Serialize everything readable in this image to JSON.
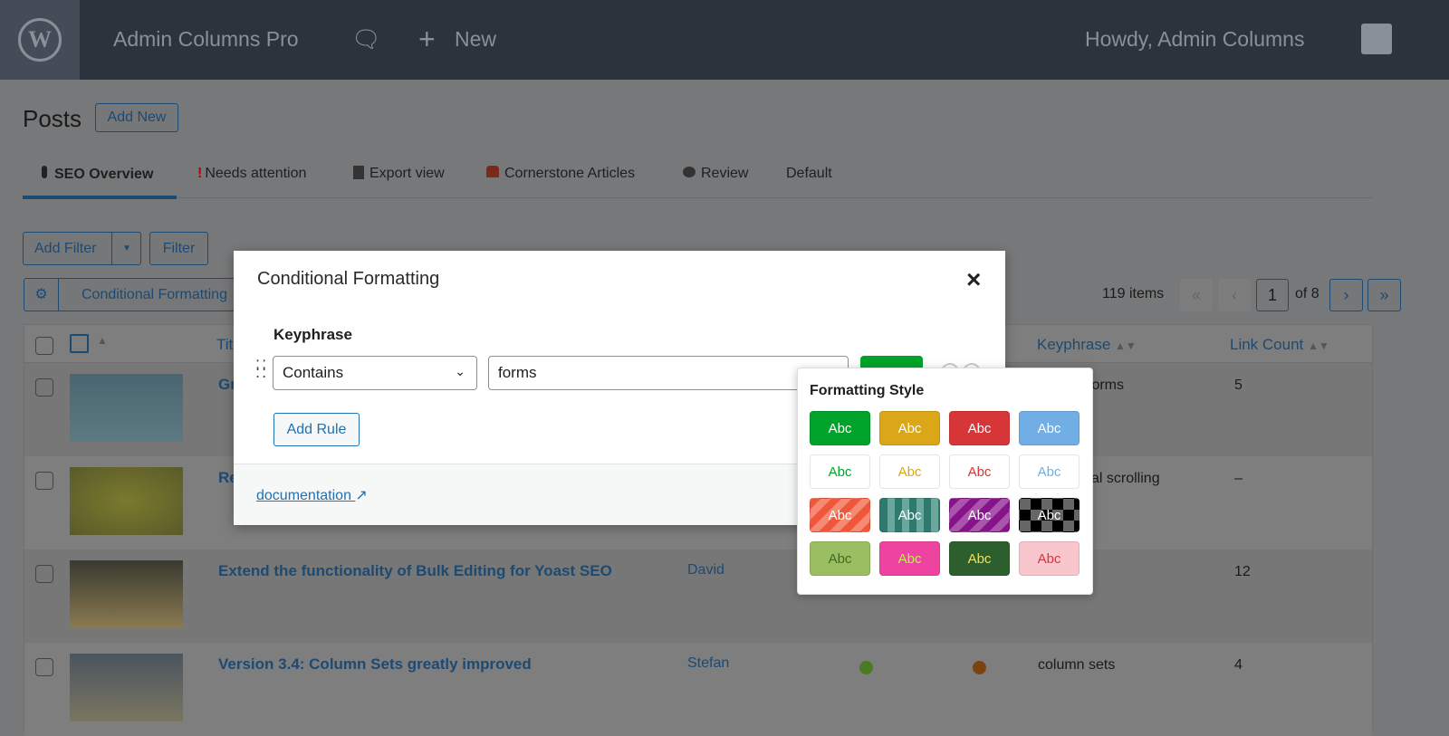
{
  "topbar": {
    "site": "Admin Columns Pro",
    "new": "New",
    "howdy": "Howdy, Admin Columns",
    "logo": "W"
  },
  "page": {
    "title": "Posts",
    "add_new": "Add New"
  },
  "tabs": [
    {
      "icon": "traffic-light",
      "label": "SEO Overview"
    },
    {
      "icon": "exclamation",
      "label": "Needs attention"
    },
    {
      "icon": "cabinet",
      "label": "Export view"
    },
    {
      "icon": "stamp",
      "label": "Cornerstone Articles"
    },
    {
      "icon": "eye",
      "label": "Review"
    },
    {
      "icon": "",
      "label": "Default"
    }
  ],
  "filters": {
    "add_filter": "Add Filter",
    "filter": "Filter",
    "conditional": "Conditional Formatting"
  },
  "pagination": {
    "items": "119 items",
    "current": "1",
    "of": "of 8",
    "first": "«",
    "prev": "‹",
    "next": "›",
    "last": "»"
  },
  "table": {
    "columns": {
      "title": "Title",
      "keyphrase": "Keyphrase",
      "link_count": "Link Count"
    },
    "rows": [
      {
        "title": "Gr",
        "author": "",
        "seo": "",
        "read": "",
        "keyphrase": "forms",
        "links": "5"
      },
      {
        "title": "Re",
        "author": "",
        "seo": "",
        "read": "",
        "keyphrase": "al scrolling",
        "links": "–"
      },
      {
        "title": "Extend the functionality of Bulk Editing for Yoast SEO",
        "author": "David",
        "seo": "",
        "read": "",
        "keyphrase": "",
        "links": "12"
      },
      {
        "title": "Version 3.4: Column Sets greatly improved",
        "author": "Stefan",
        "seo": "#4a7a22",
        "read": "#7a4410",
        "keyphrase": "column sets",
        "links": "4"
      }
    ]
  },
  "modal": {
    "title": "Conditional Formatting",
    "field": "Keyphrase",
    "operator": "Contains",
    "value": "forms",
    "add_rule": "Add Rule",
    "documentation": "documentation",
    "close": "×",
    "style_color": "#00a32a"
  },
  "popover": {
    "title": "Formatting Style",
    "swatches": [
      {
        "label": "Abc",
        "bg": "#00a32a",
        "fg": "#ffffff"
      },
      {
        "label": "Abc",
        "bg": "#dba617",
        "fg": "#ffffff"
      },
      {
        "label": "Abc",
        "bg": "#d63638",
        "fg": "#ffffff"
      },
      {
        "label": "Abc",
        "bg": "#72aee6",
        "fg": "#ffffff"
      },
      {
        "label": "Abc",
        "bg": "#ffffff",
        "fg": "#00a32a"
      },
      {
        "label": "Abc",
        "bg": "#ffffff",
        "fg": "#dba617"
      },
      {
        "label": "Abc",
        "bg": "#ffffff",
        "fg": "#d63638"
      },
      {
        "label": "Abc",
        "bg": "#ffffff",
        "fg": "#72aee6"
      },
      {
        "label": "Abc",
        "bg": "repeating-linear-gradient(135deg,#f0573a 0 8px,#f58a75 8px 16px)",
        "fg": "#ffffff"
      },
      {
        "label": "Abc",
        "bg": "repeating-linear-gradient(90deg,#2f7a6e 0 8px,#6aa79d 8px 16px)",
        "fg": "#ffffff"
      },
      {
        "label": "Abc",
        "bg": "repeating-linear-gradient(135deg,#87138a 0 8px,#a955ab 8px 16px)",
        "fg": "#ffffff"
      },
      {
        "label": "Abc",
        "bg": "repeating-conic-gradient(#000 0 25%,#666 0 50%) 0 0/24px 24px",
        "fg": "#ffffff"
      },
      {
        "label": "Abc",
        "bg": "#9bbe63",
        "fg": "#3d6a1c"
      },
      {
        "label": "Abc",
        "bg": "#ee43a0",
        "fg": "#c5f050"
      },
      {
        "label": "Abc",
        "bg": "#2d5e2d",
        "fg": "#f0e060"
      },
      {
        "label": "Abc",
        "bg": "#f8c6cc",
        "fg": "#d63638"
      }
    ]
  }
}
